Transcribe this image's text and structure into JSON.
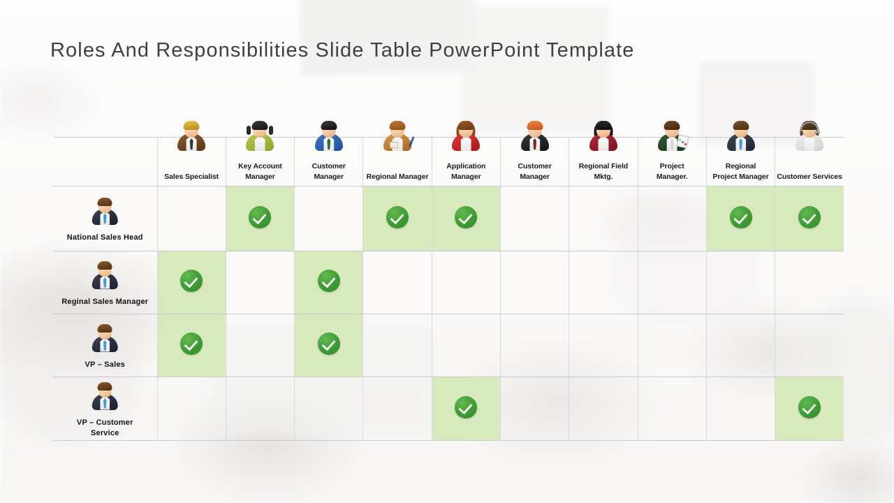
{
  "title": "Roles And Responsibilities Slide Table PowerPoint Template",
  "table": {
    "corner_label": "",
    "columns": [
      {
        "label": "Sales Specialist",
        "icon": "person-icon-sales-specialist"
      },
      {
        "label": "Key Account\nManager",
        "icon": "person-icon-key-account-manager"
      },
      {
        "label": "Customer\nManager",
        "icon": "person-icon-customer-manager"
      },
      {
        "label": "Regional Manager",
        "icon": "person-icon-regional-manager"
      },
      {
        "label": "Application\nManager",
        "icon": "person-icon-application-manager"
      },
      {
        "label": "Customer\nManager",
        "icon": "person-icon-customer-manager-2"
      },
      {
        "label": "Regional Field\nMktg.",
        "icon": "person-icon-regional-field-mktg"
      },
      {
        "label": "Project\nManager.",
        "icon": "person-icon-project-manager"
      },
      {
        "label": "Regional\nProject Manager",
        "icon": "person-icon-regional-project-manager"
      },
      {
        "label": "Customer Services",
        "icon": "person-icon-customer-services"
      }
    ],
    "rows": [
      {
        "label": "National Sales Head",
        "icon": "person-icon-national-sales-head",
        "checks": [
          false,
          true,
          false,
          true,
          true,
          false,
          false,
          false,
          true,
          true
        ]
      },
      {
        "label": "Reginal Sales Manager",
        "icon": "person-icon-reginal-sales-manager",
        "checks": [
          true,
          false,
          true,
          false,
          false,
          false,
          false,
          false,
          false,
          false
        ]
      },
      {
        "label": "VP – Sales",
        "icon": "person-icon-vp-sales",
        "checks": [
          true,
          false,
          true,
          false,
          false,
          false,
          false,
          false,
          false,
          false
        ]
      },
      {
        "label": "VP – Customer\nService",
        "icon": "person-icon-vp-customer-service",
        "checks": [
          false,
          false,
          false,
          false,
          true,
          false,
          false,
          false,
          false,
          true
        ]
      }
    ],
    "check_icon": "green-check-circle-icon"
  },
  "colors": {
    "title_text": "#3f4043",
    "cell_highlight": "#d7e9bd",
    "check_green": "#3d9b33",
    "grid_line": "#c9c9c9",
    "label_text": "#121212",
    "background": "#fbfaf9"
  }
}
